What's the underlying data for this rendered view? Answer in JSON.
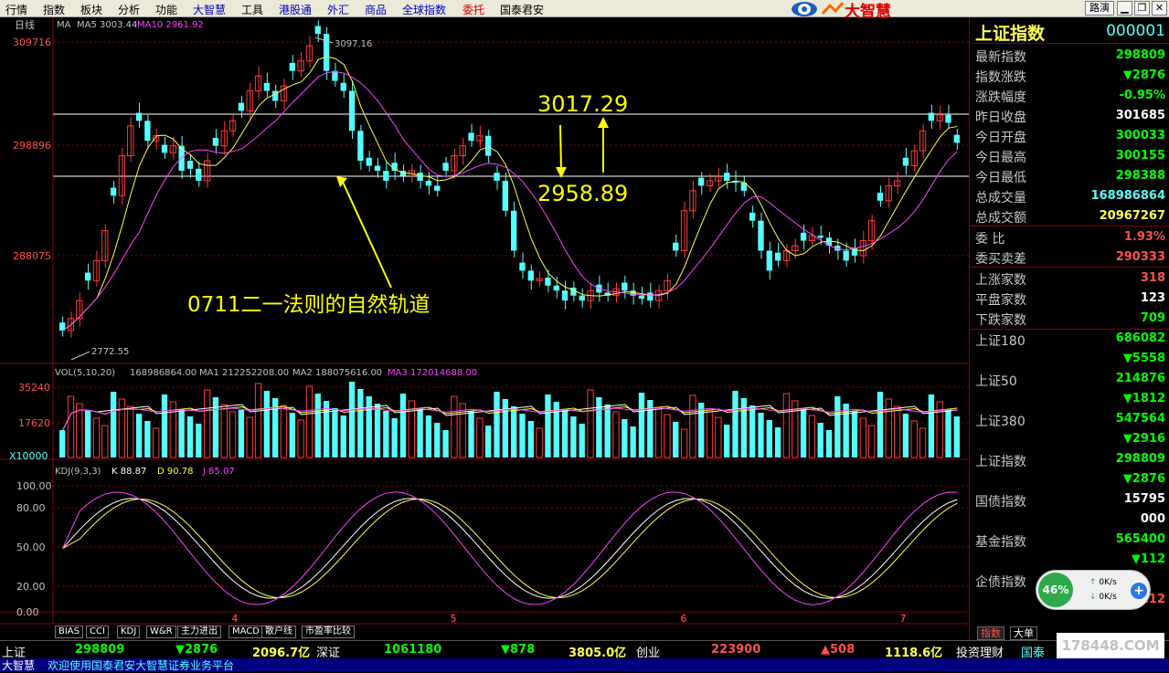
{
  "menu": {
    "items": [
      {
        "label": "行情",
        "style": "normal"
      },
      {
        "label": "指数",
        "style": "normal"
      },
      {
        "label": "板块",
        "style": "normal"
      },
      {
        "label": "分析",
        "style": "normal"
      },
      {
        "label": "功能",
        "style": "normal"
      },
      {
        "label": "大智慧",
        "style": "blue"
      },
      {
        "label": "工具",
        "style": "normal"
      },
      {
        "label": "港股通",
        "style": "blue"
      },
      {
        "label": "外汇",
        "style": "blue"
      },
      {
        "label": "商品",
        "style": "blue"
      },
      {
        "label": "全球指数",
        "style": "blue"
      },
      {
        "label": "委托",
        "style": "red"
      },
      {
        "label": "国泰君安",
        "style": "normal"
      }
    ],
    "brand": "大智慧",
    "right_button": "路演"
  },
  "chart": {
    "period_label": "日线",
    "ma_legend": {
      "prefix": "MA",
      "ma5": "MA5  3003.44",
      "ma10": "MA10  2961.92"
    },
    "price_ticks": [
      "309716",
      "298896",
      "288075"
    ],
    "high_label": "3097.16",
    "low_label": "2772.55",
    "annotation_upper": "3017.29",
    "annotation_lower": "2958.89",
    "annotation_text": "0711二一法则的自然轨道",
    "vol_legend": {
      "prefix": "VOL(5,10,20)",
      "value": "168986864.00",
      "ma1": "MA1  212252208.00",
      "ma2": "MA2  188075616.00",
      "ma3": "MA3  172014688.00"
    },
    "vol_ticks": [
      "35240",
      "17620",
      "X10000"
    ],
    "kdj_legend": {
      "prefix": "KDJ(9,3,3)",
      "k": "K  88.87",
      "d": "D  90.78",
      "j": "J  85.07"
    },
    "kdj_ticks": [
      "100.00",
      "80.00",
      "50.00",
      "20.00",
      "0.00"
    ],
    "month_labels": [
      "4",
      "5",
      "6",
      "7"
    ],
    "indicator_tabs": [
      "BIAS",
      "CCI",
      "KDJ",
      "W&R",
      "主力进出",
      "MACD",
      "散户线",
      "市盈率比较"
    ],
    "colors": {
      "up": "#ff3a3a",
      "down": "#54ffff",
      "ma5": "#ffff40",
      "ma10": "#ff40ff",
      "ma_white": "#ffffff",
      "annotation": "#ffff00",
      "axis": "#8b0000"
    }
  },
  "chart_data": {
    "type": "candlestick",
    "title": "上证指数 日线",
    "ylim": [
      2772.55,
      3097.16
    ],
    "series": [
      {
        "name": "MA5",
        "values": [
          3003.44
        ]
      },
      {
        "name": "MA10",
        "values": [
          2961.92
        ]
      }
    ],
    "annotations": [
      "3017.29",
      "2958.89",
      "0711二一法则的自然轨道"
    ]
  },
  "panel": {
    "title": "上证指数",
    "code": "000001",
    "quotes": [
      {
        "label": "最新指数",
        "value": "298809",
        "color": "green"
      },
      {
        "label": "指数涨跌",
        "value": "▼2876",
        "color": "green"
      },
      {
        "label": "涨跌幅度",
        "value": "-0.95%",
        "color": "green"
      },
      {
        "label": "昨日收盘",
        "value": "301685",
        "color": "white"
      },
      {
        "label": "今日开盘",
        "value": "300033",
        "color": "green"
      },
      {
        "label": "今日最高",
        "value": "300155",
        "color": "green"
      },
      {
        "label": "今日最低",
        "value": "298388",
        "color": "green"
      },
      {
        "label": "总成交量",
        "value": "168986864",
        "color": "cyan"
      },
      {
        "label": "总成交额",
        "value": "20967267",
        "color": "yellow"
      }
    ],
    "ratio": [
      {
        "label": "委    比",
        "value": "1.93%",
        "color": "red"
      },
      {
        "label": "委买卖差",
        "value": "290333",
        "color": "red"
      }
    ],
    "breadth": [
      {
        "label": "上涨家数",
        "value": "318",
        "color": "red"
      },
      {
        "label": "平盘家数",
        "value": "123",
        "color": "white"
      },
      {
        "label": "下跌家数",
        "value": "709",
        "color": "green"
      }
    ],
    "indices": [
      {
        "label": "上证180",
        "value": "686082",
        "change": "▼5558"
      },
      {
        "label": "上证50",
        "value": "214876",
        "change": "▼1812"
      },
      {
        "label": "上证380",
        "value": "547564",
        "change": "▼2916"
      },
      {
        "label": "上证指数",
        "value": "298809",
        "change": "▼2876"
      },
      {
        "label": "国债指数",
        "value": "15795",
        "change": "000"
      },
      {
        "label": "基金指数",
        "value": "565400",
        "change": "▼112"
      },
      {
        "label": "企债指数",
        "value": "",
        "change": "112"
      }
    ],
    "tabs": [
      "指数",
      "大单"
    ]
  },
  "speed": {
    "percent": "46%",
    "up": "0K/s",
    "down": "0K/s"
  },
  "status": {
    "sh_label": "上证",
    "sh_value": "298809",
    "sh_change": "▼2876",
    "sh_amount": "2096.7亿",
    "sz_label": "深证",
    "sz_value": "1061180",
    "sz_change": "▼878",
    "sz_amount": "3805.0亿",
    "cy_label": "创业",
    "cy_value": "223900",
    "cy_change": "▲508",
    "cy_amount": "1118.6亿",
    "tail1": "投资理财",
    "tail2": "国泰",
    "ticker_brand": "大智慧",
    "ticker_text": "欢迎使用国泰君安大智慧证券业务平台"
  },
  "watermark": "178448.COM"
}
